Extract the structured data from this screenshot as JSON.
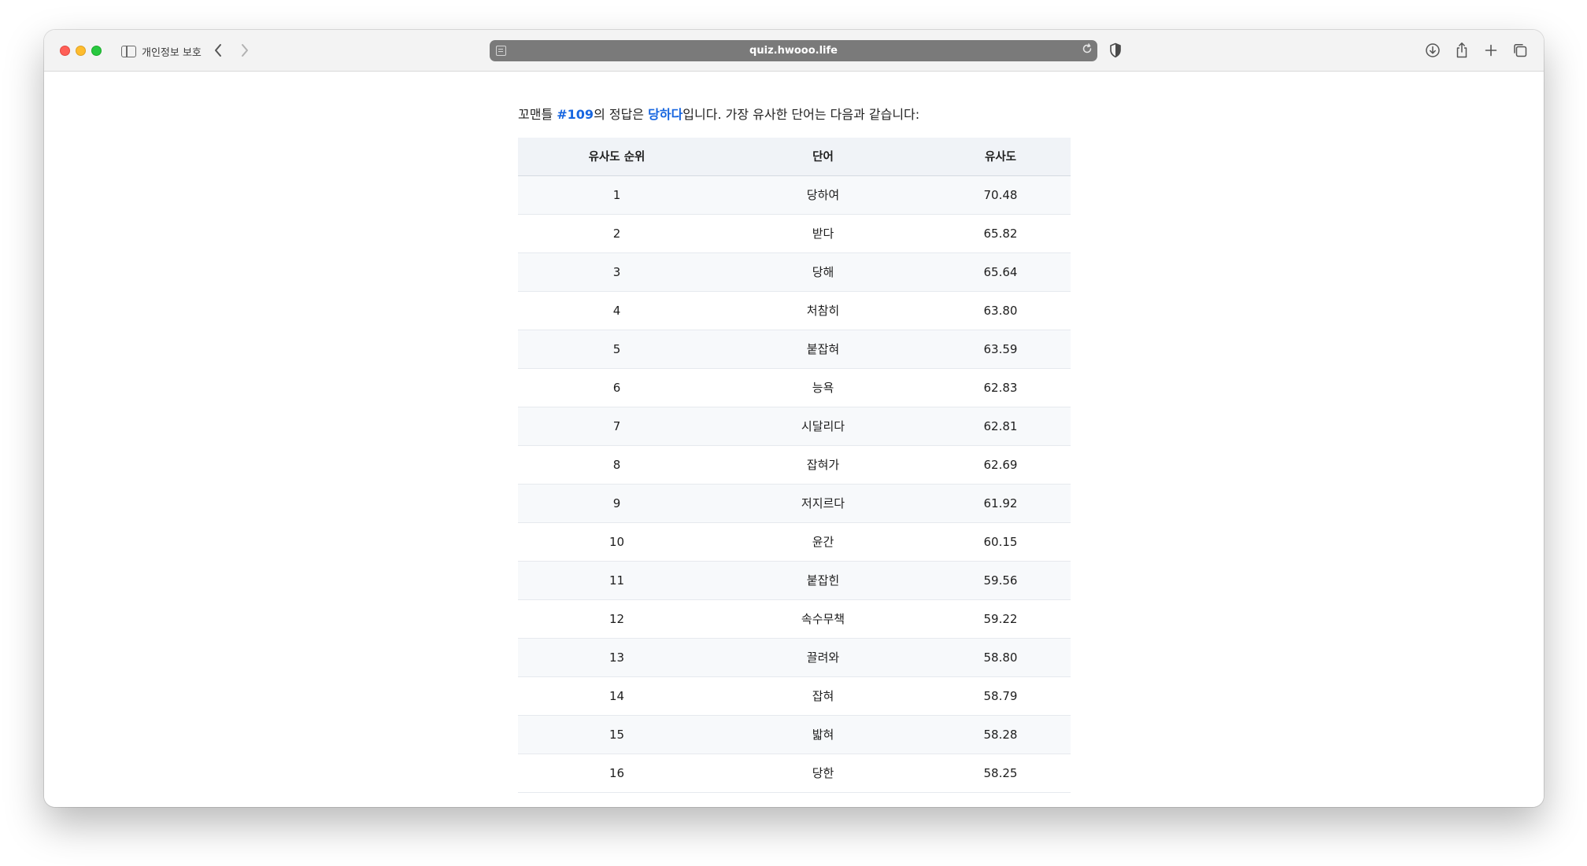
{
  "browser": {
    "sidebar_label": "개인정보 보호",
    "url": "quiz.hwooo.life",
    "icons": {
      "sidebar": "sidebar-icon",
      "back": "chevron-left-icon",
      "forward": "chevron-right-icon",
      "page": "page-icon",
      "reload": "reload-icon",
      "shield": "shield-icon",
      "download": "download-icon",
      "share": "share-icon",
      "new_tab": "plus-icon",
      "tabs": "tab-overview-icon"
    }
  },
  "page": {
    "intro": {
      "prefix": "꼬맨틀 ",
      "puzzle_number": "#109",
      "middle": "의 정답은 ",
      "answer": "당하다",
      "suffix": "입니다. 가장 유사한 단어는 다음과 같습니다:"
    },
    "table": {
      "headers": [
        "유사도 순위",
        "단어",
        "유사도"
      ],
      "rows": [
        {
          "rank": "1",
          "word": "당하여",
          "score": "70.48"
        },
        {
          "rank": "2",
          "word": "받다",
          "score": "65.82"
        },
        {
          "rank": "3",
          "word": "당해",
          "score": "65.64"
        },
        {
          "rank": "4",
          "word": "처참히",
          "score": "63.80"
        },
        {
          "rank": "5",
          "word": "붙잡혀",
          "score": "63.59"
        },
        {
          "rank": "6",
          "word": "능욕",
          "score": "62.83"
        },
        {
          "rank": "7",
          "word": "시달리다",
          "score": "62.81"
        },
        {
          "rank": "8",
          "word": "잡혀가",
          "score": "62.69"
        },
        {
          "rank": "9",
          "word": "저지르다",
          "score": "61.92"
        },
        {
          "rank": "10",
          "word": "윤간",
          "score": "60.15"
        },
        {
          "rank": "11",
          "word": "붙잡힌",
          "score": "59.56"
        },
        {
          "rank": "12",
          "word": "속수무책",
          "score": "59.22"
        },
        {
          "rank": "13",
          "word": "끌려와",
          "score": "58.80"
        },
        {
          "rank": "14",
          "word": "잡혀",
          "score": "58.79"
        },
        {
          "rank": "15",
          "word": "밟혀",
          "score": "58.28"
        },
        {
          "rank": "16",
          "word": "당한",
          "score": "58.25"
        }
      ]
    },
    "colors": {
      "link": "#1766e0",
      "header_bg": "#f0f3f7",
      "stripe_bg": "#f7f9fb"
    }
  }
}
